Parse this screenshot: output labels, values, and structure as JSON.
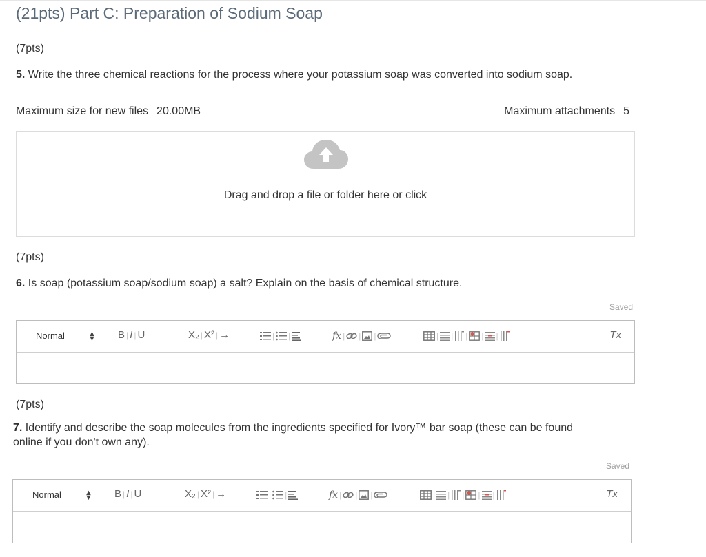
{
  "page": {
    "title": "(21pts) Part C: Preparation of Sodium Soap"
  },
  "questions": [
    {
      "points": "(7pts)",
      "number": "5.",
      "text": "Write the three chemical reactions for the process where your potassium soap was converted into sodium soap."
    },
    {
      "points": "(7pts)",
      "number": "6.",
      "text": "Is soap (potassium soap/sodium soap) a salt? Explain on the basis of chemical structure.",
      "status": "Saved"
    },
    {
      "points": "(7pts)",
      "number": "7.",
      "text_line1": "Identify and describe the soap molecules from the ingredients specified for Ivory™ bar soap (these can be found",
      "text_line2": "online if you don't own any).",
      "status": "Saved"
    }
  ],
  "upload": {
    "max_size_label": "Maximum size for new files",
    "max_size_value": "20.00MB",
    "max_attachments_label": "Maximum attachments",
    "max_attachments_value": "5",
    "drop_text": "Drag and drop a file or folder here or click",
    "icon": "cloud-upload-icon"
  },
  "editor_toolbar": {
    "format_value": "Normal",
    "bold": "B",
    "italic": "I",
    "underline": "U",
    "subscript": "X₂",
    "superscript": "X²",
    "arrow": "→",
    "formula": "fx",
    "clear": "Tx",
    "icons": [
      "bold-icon",
      "italic-icon",
      "underline-icon",
      "subscript-icon",
      "superscript-icon",
      "arrow-icon",
      "ordered-list-icon",
      "bullet-list-icon",
      "align-icon",
      "formula-icon",
      "link-icon",
      "image-icon",
      "attachment-icon",
      "table-icon",
      "table-row-icon",
      "table-column-icon",
      "table-cell-icon",
      "table-delete-row-icon",
      "table-delete-column-icon",
      "clear-format-icon"
    ]
  },
  "colors": {
    "title": "#5a6a78",
    "upload_icon": "#c4c4c4",
    "border": "#bdbdbd"
  }
}
